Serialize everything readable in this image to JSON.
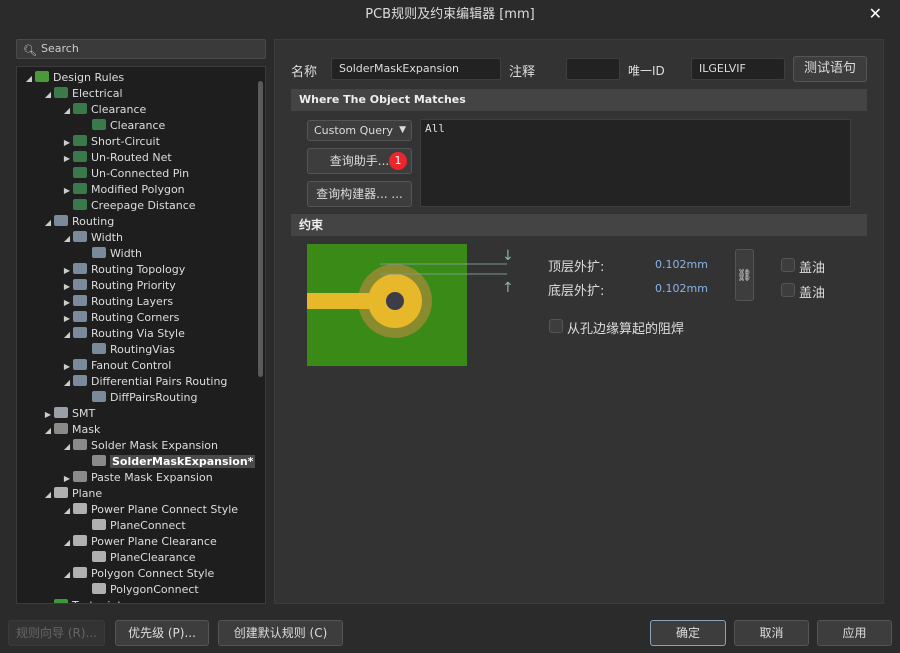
{
  "window": {
    "title": "PCB规则及约束编辑器 [mm]",
    "close_icon": "close-icon"
  },
  "search": {
    "placeholder": "Search"
  },
  "tree": [
    {
      "label": "Design Rules",
      "level": 0,
      "state": "open",
      "icon": "rules"
    },
    {
      "label": "Electrical",
      "level": 1,
      "state": "open",
      "icon": "elec"
    },
    {
      "label": "Clearance",
      "level": 2,
      "state": "open",
      "icon": "elec"
    },
    {
      "label": "Clearance",
      "level": 3,
      "state": "leaf",
      "icon": "elec"
    },
    {
      "label": "Short-Circuit",
      "level": 2,
      "state": "closed",
      "icon": "elec"
    },
    {
      "label": "Un-Routed Net",
      "level": 2,
      "state": "closed",
      "icon": "elec"
    },
    {
      "label": "Un-Connected Pin",
      "level": 2,
      "state": "none",
      "icon": "elec"
    },
    {
      "label": "Modified Polygon",
      "level": 2,
      "state": "closed",
      "icon": "elec"
    },
    {
      "label": "Creepage Distance",
      "level": 2,
      "state": "none",
      "icon": "elec"
    },
    {
      "label": "Routing",
      "level": 1,
      "state": "open",
      "icon": "route"
    },
    {
      "label": "Width",
      "level": 2,
      "state": "open",
      "icon": "route"
    },
    {
      "label": "Width",
      "level": 3,
      "state": "leaf",
      "icon": "route"
    },
    {
      "label": "Routing Topology",
      "level": 2,
      "state": "closed",
      "icon": "route"
    },
    {
      "label": "Routing Priority",
      "level": 2,
      "state": "closed",
      "icon": "route"
    },
    {
      "label": "Routing Layers",
      "level": 2,
      "state": "closed",
      "icon": "route"
    },
    {
      "label": "Routing Corners",
      "level": 2,
      "state": "closed",
      "icon": "route"
    },
    {
      "label": "Routing Via Style",
      "level": 2,
      "state": "open",
      "icon": "route"
    },
    {
      "label": "RoutingVias",
      "level": 3,
      "state": "leaf",
      "icon": "route"
    },
    {
      "label": "Fanout Control",
      "level": 2,
      "state": "closed",
      "icon": "route"
    },
    {
      "label": "Differential Pairs Routing",
      "level": 2,
      "state": "open",
      "icon": "route"
    },
    {
      "label": "DiffPairsRouting",
      "level": 3,
      "state": "leaf",
      "icon": "route"
    },
    {
      "label": "SMT",
      "level": 1,
      "state": "closed",
      "icon": "smt"
    },
    {
      "label": "Mask",
      "level": 1,
      "state": "open",
      "icon": "mask"
    },
    {
      "label": "Solder Mask Expansion",
      "level": 2,
      "state": "open",
      "icon": "mask"
    },
    {
      "label": "SolderMaskExpansion*",
      "level": 3,
      "state": "leaf",
      "icon": "mask",
      "selected": true
    },
    {
      "label": "Paste Mask Expansion",
      "level": 2,
      "state": "closed",
      "icon": "mask"
    },
    {
      "label": "Plane",
      "level": 1,
      "state": "open",
      "icon": "plane"
    },
    {
      "label": "Power Plane Connect Style",
      "level": 2,
      "state": "open",
      "icon": "plane"
    },
    {
      "label": "PlaneConnect",
      "level": 3,
      "state": "leaf",
      "icon": "plane"
    },
    {
      "label": "Power Plane Clearance",
      "level": 2,
      "state": "open",
      "icon": "plane"
    },
    {
      "label": "PlaneClearance",
      "level": 3,
      "state": "leaf",
      "icon": "plane"
    },
    {
      "label": "Polygon Connect Style",
      "level": 2,
      "state": "open",
      "icon": "plane"
    },
    {
      "label": "PolygonConnect",
      "level": 3,
      "state": "leaf",
      "icon": "plane"
    },
    {
      "label": "Testpoint",
      "level": 1,
      "state": "open",
      "icon": "test"
    }
  ],
  "form": {
    "name_label": "名称",
    "name_value": "SolderMaskExpansion",
    "comment_label": "注释",
    "comment_value": "",
    "id_label": "唯一ID",
    "id_value": "ILGELVIF",
    "test_button": "测试语句"
  },
  "match": {
    "title": "Where The Object Matches",
    "query_type": "Custom Query",
    "helper_button": "查询助手...",
    "helper_badge": "1",
    "builder_button": "查询构建器... ...",
    "query_text": "All"
  },
  "constraints": {
    "title": "约束",
    "top_label": "顶层外扩:",
    "top_value": "0.102mm",
    "bottom_label": "底层外扩:",
    "bottom_value": "0.102mm",
    "tent_top": "盖油",
    "tent_bottom": "盖油",
    "from_hole": "从孔边缘算起的阻焊",
    "link_icon": "link-icon"
  },
  "footer": {
    "wizard": "规则向导 (R)...",
    "priority": "优先级 (P)...",
    "create_default": "创建默认规则 (C)",
    "ok": "确定",
    "cancel": "取消",
    "apply": "应用"
  },
  "colors": {
    "board": "#3a8a17",
    "copper": "#e6b82a",
    "mask": "#8a8a2e",
    "badge": "#e8262b",
    "value": "#8ab4e8"
  }
}
